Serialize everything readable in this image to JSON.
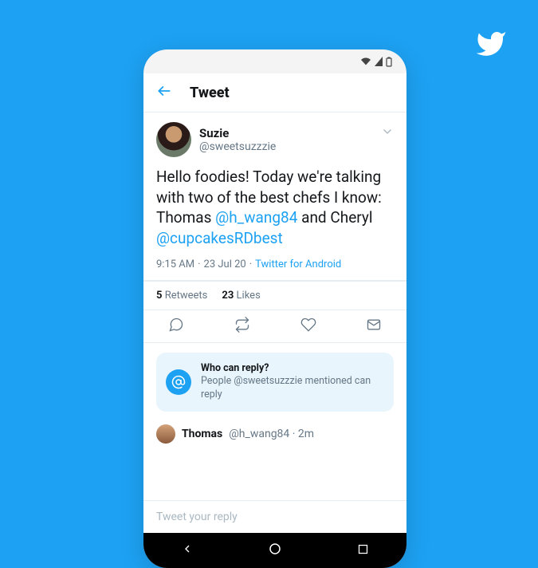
{
  "brand_color": "#1DA1F2",
  "topbar": {
    "title": "Tweet"
  },
  "tweet": {
    "author": {
      "display_name": "Suzie",
      "handle": "@sweetsuzzzie"
    },
    "text": {
      "seg1": "Hello foodies! Today we're talking with two of the best chefs I know: Thomas ",
      "mention1": "@h_wang84",
      "seg2": " and Cheryl ",
      "mention2": "@cupcakesRDbest"
    },
    "meta": {
      "time": "9:15 AM",
      "date": "23 Jul 20",
      "source": "Twitter for Android"
    },
    "stats": {
      "retweets_count": "5",
      "retweets_label": "Retweets",
      "likes_count": "23",
      "likes_label": "Likes"
    }
  },
  "who_can_reply": {
    "title": "Who can reply?",
    "subtitle": "People @sweetsuzzzie mentioned can reply"
  },
  "reply_preview": {
    "name": "Thomas",
    "handle": "@h_wang84",
    "time": "2m"
  },
  "compose": {
    "placeholder": "Tweet your reply"
  }
}
